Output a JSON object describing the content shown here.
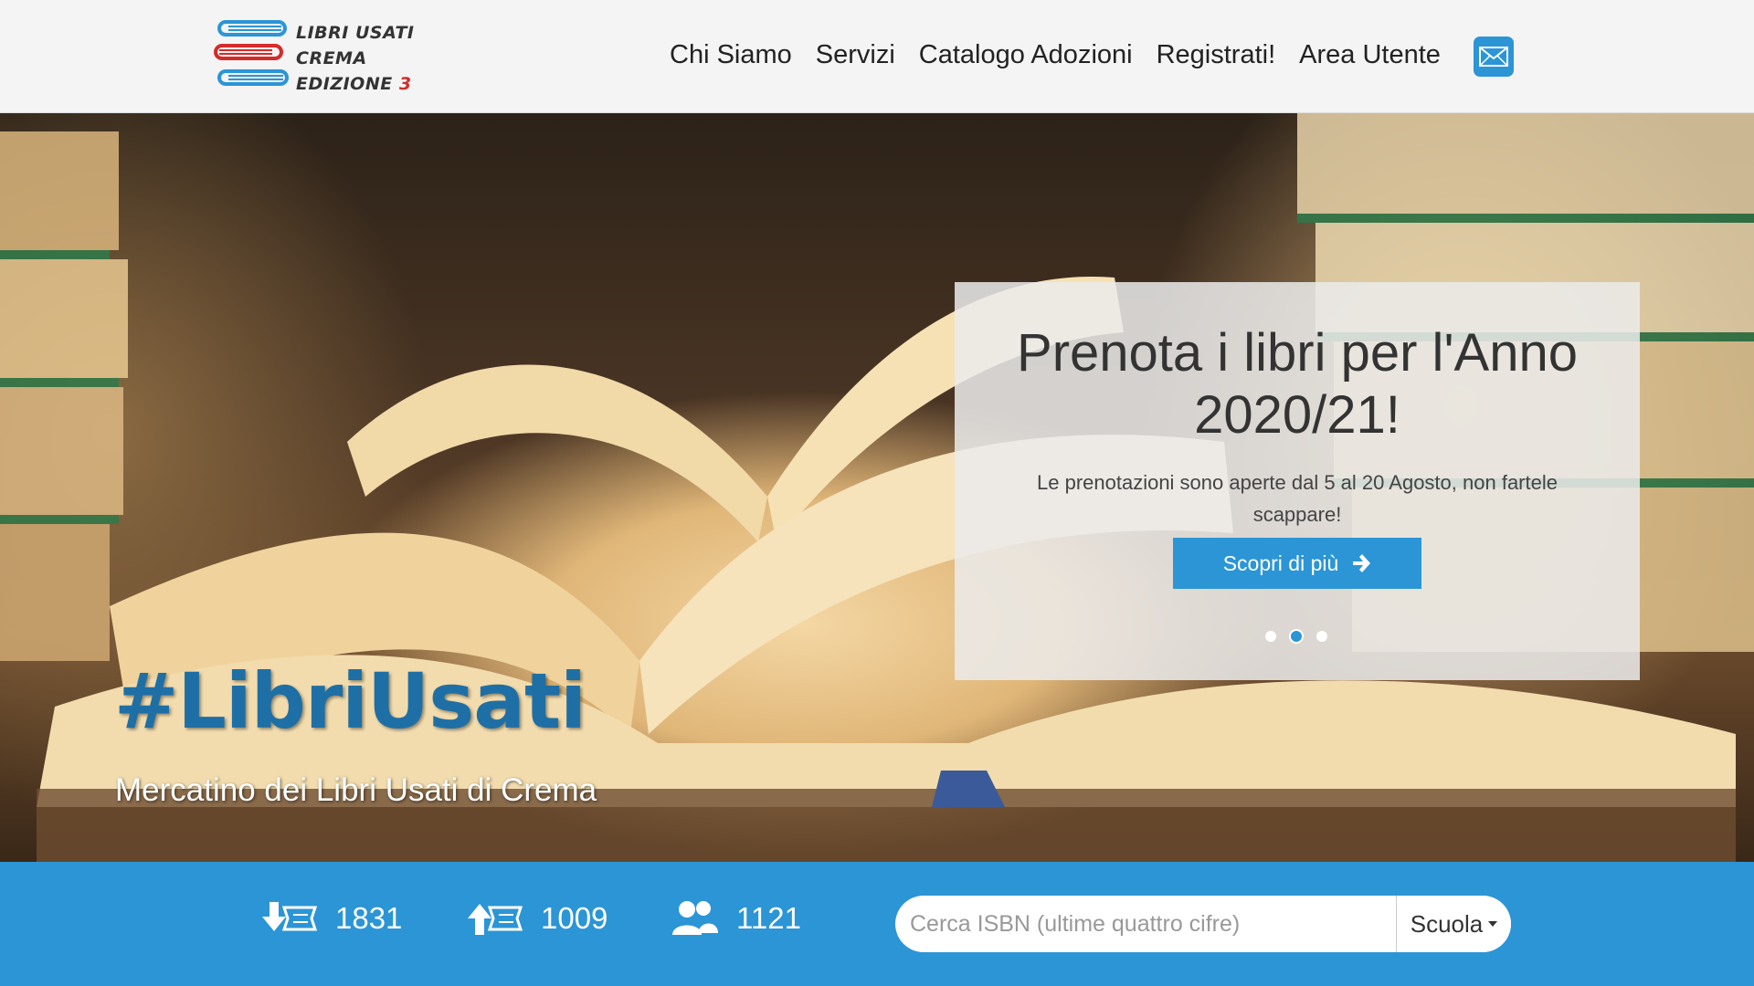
{
  "logo": {
    "line1": "LIBRI USATI",
    "line2": "CREMA",
    "line3_prefix": "EDIZIONE ",
    "line3_number": "3"
  },
  "nav": {
    "items": [
      {
        "label": "Chi Siamo"
      },
      {
        "label": "Servizi"
      },
      {
        "label": "Catalogo Adozioni"
      },
      {
        "label": "Registrati!"
      },
      {
        "label": "Area Utente"
      }
    ],
    "mail_icon": "envelope-icon"
  },
  "hero": {
    "overlay": {
      "title": "Prenota i libri per l'Anno 2020/21!",
      "subtitle": "Le prenotazioni sono aperte dal 5 al 20 Agosto, non fartele scappare!",
      "button_label": "Scopri di più",
      "button_icon": "arrow-right-icon",
      "carousel_active_index": 1,
      "carousel_count": 3
    },
    "hashtag": "#LibriUsati",
    "tagline": "Mercatino dei Libri Usati di Crema"
  },
  "stats": {
    "books_in": {
      "icon": "books-down-icon",
      "value": "1831"
    },
    "books_out": {
      "icon": "books-up-icon",
      "value": "1009"
    },
    "users": {
      "icon": "users-icon",
      "value": "1121"
    }
  },
  "search": {
    "placeholder": "Cerca ISBN (ultime quattro cifre)",
    "value": "",
    "dropdown_label": "Scuola"
  },
  "colors": {
    "accent": "#2b95d6",
    "header_bg": "#f4f4f4",
    "hashtag": "#1e6fa5"
  }
}
